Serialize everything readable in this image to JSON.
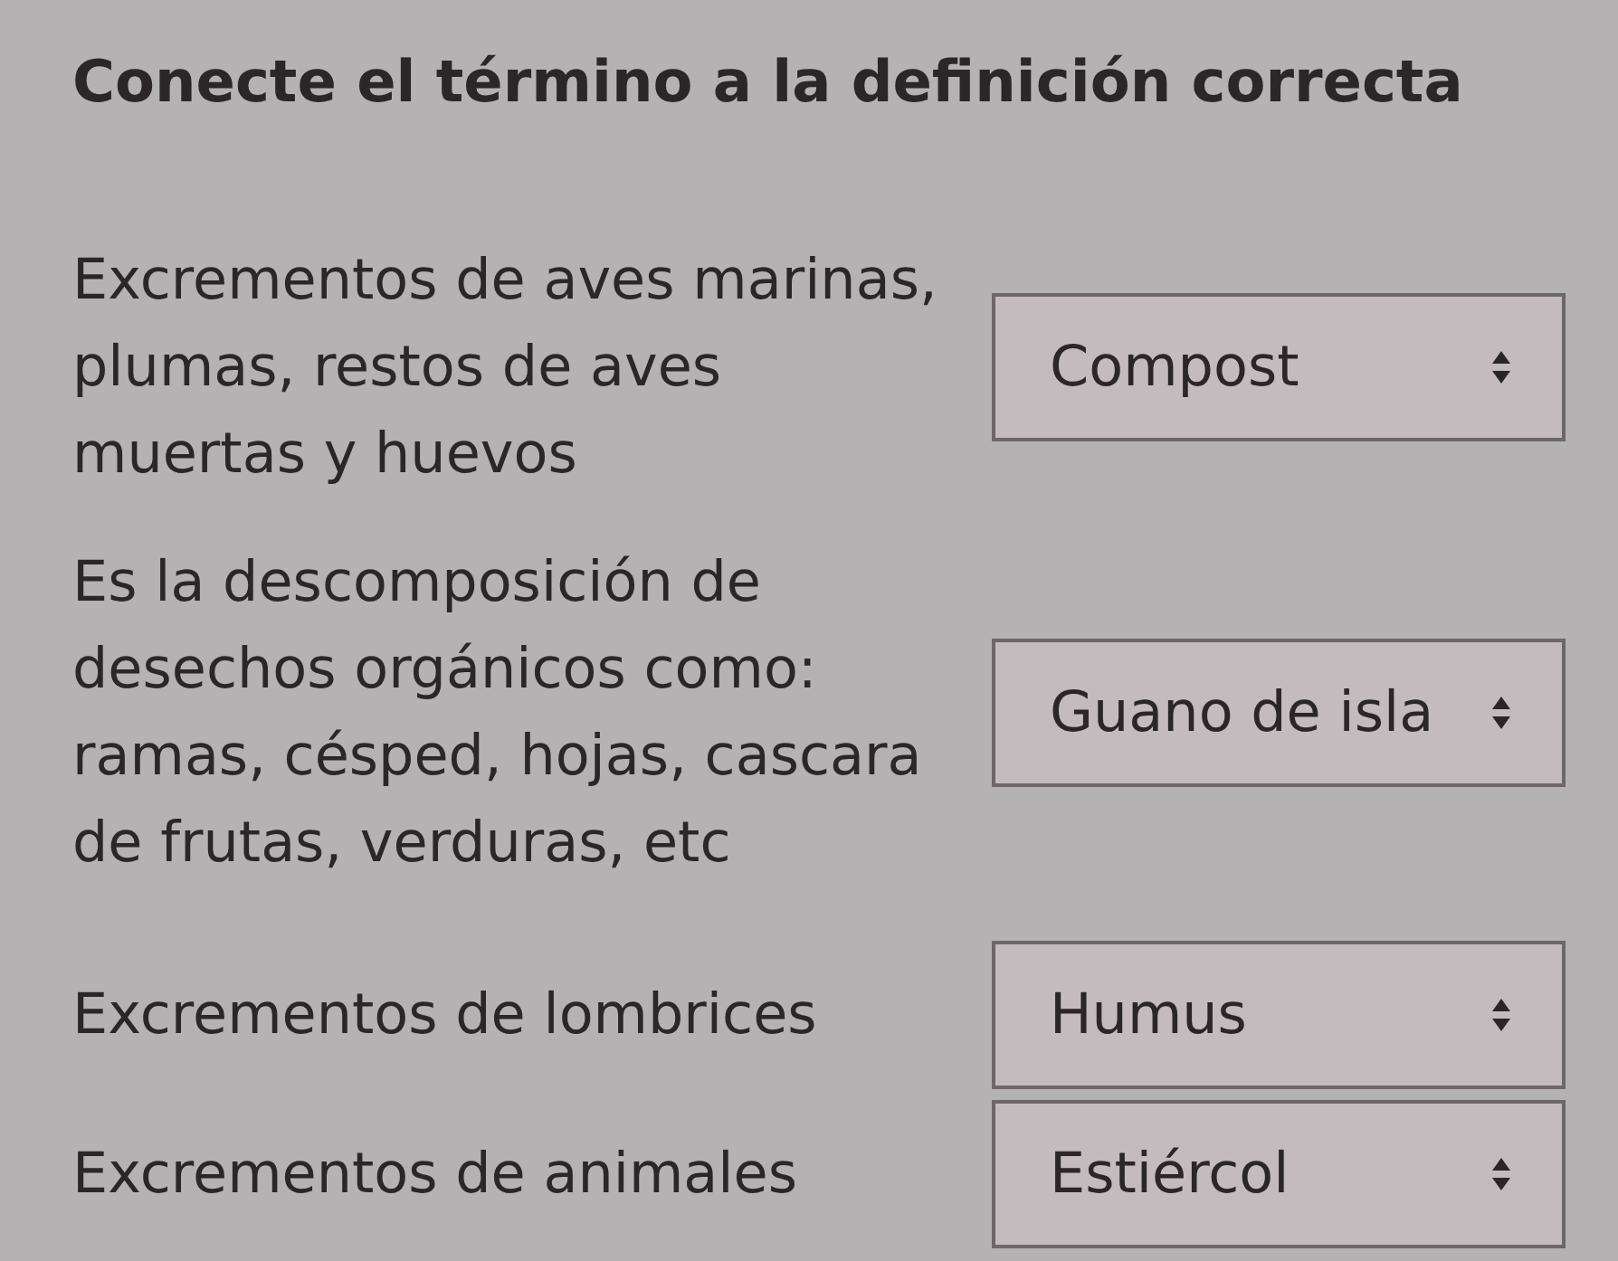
{
  "title": "Conecte el término a la definición correcta",
  "items": [
    {
      "definition": "Excrementos de aves marinas, plumas, restos de aves muertas y huevos",
      "value": "Compost"
    },
    {
      "definition": "Es la descomposición de desechos orgánicos como: ramas, césped, hojas, cascara de frutas, verduras, etc",
      "value": "Guano de isla"
    },
    {
      "definition": "Excrementos de lombrices",
      "value": "Humus"
    },
    {
      "definition": "Excrementos de animales",
      "value": "Estiércol"
    }
  ]
}
